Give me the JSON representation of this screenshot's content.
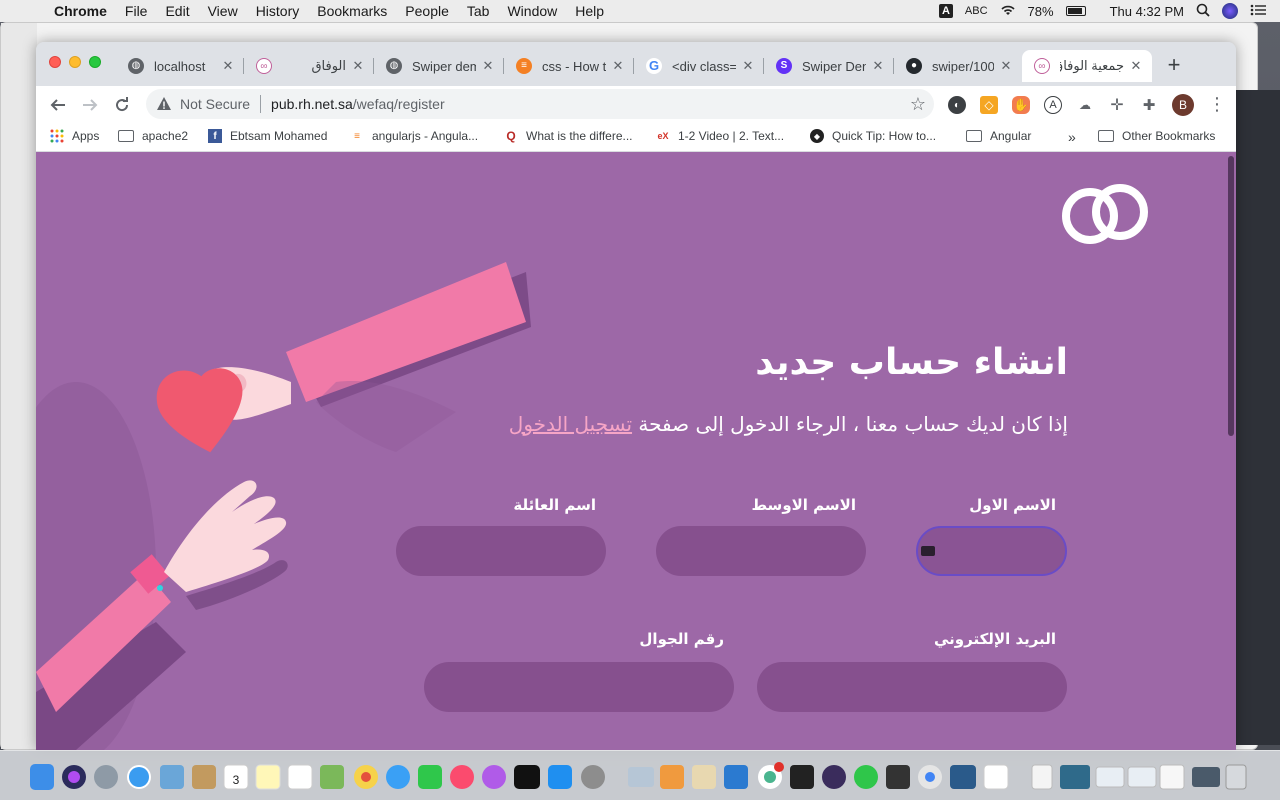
{
  "menubar": {
    "app": "Chrome",
    "items": [
      "File",
      "Edit",
      "View",
      "History",
      "Bookmarks",
      "People",
      "Tab",
      "Window",
      "Help"
    ],
    "input_source": "ABC",
    "battery": "78%",
    "clock": "Thu 4:32 PM"
  },
  "tabs": [
    {
      "title": "localhost"
    },
    {
      "title": "الوفاق"
    },
    {
      "title": "Swiper dem"
    },
    {
      "title": "css - How t"
    },
    {
      "title": "<div class="
    },
    {
      "title": "Swiper Den"
    },
    {
      "title": "swiper/100"
    },
    {
      "title": "جمعية الوفاق",
      "active": true
    }
  ],
  "omnibox": {
    "security": "Not Secure",
    "host": "pub.rh.net.sa",
    "path": "/wefaq/register"
  },
  "profile_initial": "B",
  "bookmarks": [
    {
      "label": "Apps"
    },
    {
      "label": "apache2"
    },
    {
      "label": "Ebtsam Mohamed"
    },
    {
      "label": "angularjs - Angula..."
    },
    {
      "label": "What is the differe..."
    },
    {
      "label": "1-2 Video | 2. Text..."
    },
    {
      "label": "Quick Tip: How to..."
    },
    {
      "label": "Angular"
    },
    {
      "label": "Other Bookmarks"
    }
  ],
  "page": {
    "title": "انشاء حساب جديد",
    "subtitle": "إذا كان لديك حساب معنا ، الرجاء الدخول إلى صفحة",
    "login_link": "تسجيل الدخول",
    "fields": {
      "first_name": "الاسم الاول",
      "middle_name": "الاسم الاوسط",
      "family_name": "اسم العائلة",
      "email": "البريد الإلكتروني",
      "mobile": "رقم الجوال"
    }
  }
}
